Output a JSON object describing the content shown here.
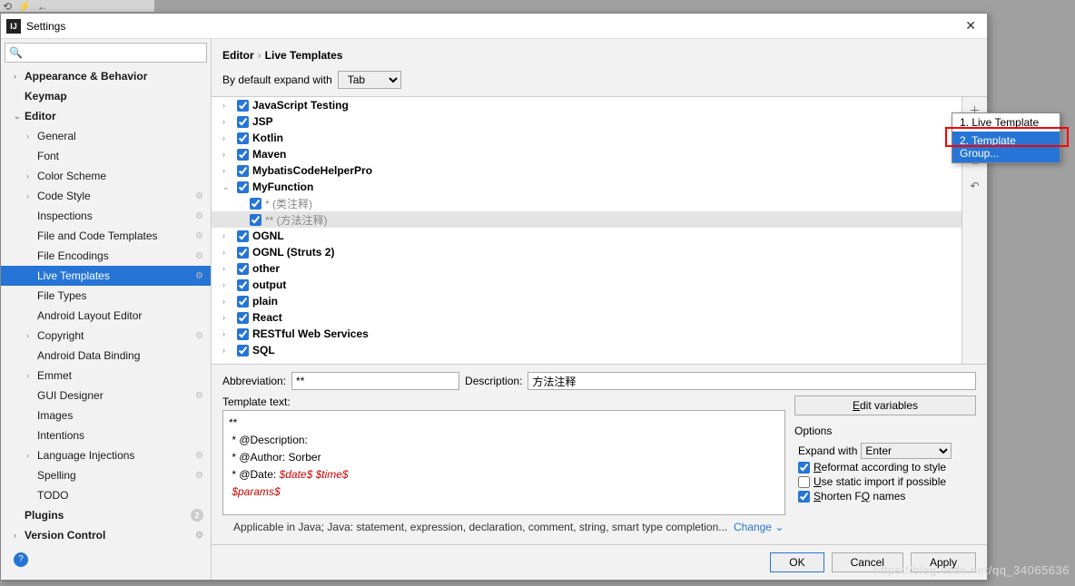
{
  "titlebar": {
    "title": "Settings"
  },
  "search": {
    "placeholder": ""
  },
  "sidebar": [
    {
      "label": "Appearance & Behavior",
      "lvl": 1,
      "bold": true,
      "arrow": "›"
    },
    {
      "label": "Keymap",
      "lvl": 1,
      "bold": true,
      "arrow": ""
    },
    {
      "label": "Editor",
      "lvl": 1,
      "bold": true,
      "arrow": "⌄"
    },
    {
      "label": "General",
      "lvl": 2,
      "arrow": "›"
    },
    {
      "label": "Font",
      "lvl": 2,
      "arrow": ""
    },
    {
      "label": "Color Scheme",
      "lvl": 2,
      "arrow": "›"
    },
    {
      "label": "Code Style",
      "lvl": 2,
      "arrow": "›",
      "gear": true
    },
    {
      "label": "Inspections",
      "lvl": 2,
      "arrow": "",
      "gear": true
    },
    {
      "label": "File and Code Templates",
      "lvl": 2,
      "arrow": "",
      "gear": true
    },
    {
      "label": "File Encodings",
      "lvl": 2,
      "arrow": "",
      "gear": true
    },
    {
      "label": "Live Templates",
      "lvl": 2,
      "arrow": "",
      "gear": true,
      "selected": true
    },
    {
      "label": "File Types",
      "lvl": 2,
      "arrow": ""
    },
    {
      "label": "Android Layout Editor",
      "lvl": 2,
      "arrow": ""
    },
    {
      "label": "Copyright",
      "lvl": 2,
      "arrow": "›",
      "gear": true
    },
    {
      "label": "Android Data Binding",
      "lvl": 2,
      "arrow": ""
    },
    {
      "label": "Emmet",
      "lvl": 2,
      "arrow": "›"
    },
    {
      "label": "GUI Designer",
      "lvl": 2,
      "arrow": "",
      "gear": true
    },
    {
      "label": "Images",
      "lvl": 2,
      "arrow": ""
    },
    {
      "label": "Intentions",
      "lvl": 2,
      "arrow": ""
    },
    {
      "label": "Language Injections",
      "lvl": 2,
      "arrow": "›",
      "gear": true
    },
    {
      "label": "Spelling",
      "lvl": 2,
      "arrow": "",
      "gear": true
    },
    {
      "label": "TODO",
      "lvl": 2,
      "arrow": ""
    },
    {
      "label": "Plugins",
      "lvl": 1,
      "bold": true,
      "arrow": "",
      "badge": "2"
    },
    {
      "label": "Version Control",
      "lvl": 1,
      "bold": true,
      "arrow": "›",
      "gear": true
    }
  ],
  "crumbs": {
    "a": "Editor",
    "b": "Live Templates"
  },
  "expand": {
    "label": "By default expand with",
    "value": "Tab"
  },
  "templates": [
    {
      "label": "JavaScript Testing",
      "arrow": "›",
      "bold": true
    },
    {
      "label": "JSP",
      "arrow": "›",
      "bold": true
    },
    {
      "label": "Kotlin",
      "arrow": "›",
      "bold": true
    },
    {
      "label": "Maven",
      "arrow": "›",
      "bold": true
    },
    {
      "label": "MybatisCodeHelperPro",
      "arrow": "›",
      "bold": true
    },
    {
      "label": "MyFunction",
      "arrow": "⌄",
      "bold": true
    },
    {
      "label": "* (类注释)",
      "child": true
    },
    {
      "label": "** (方法注释)",
      "child": true,
      "sel": true
    },
    {
      "label": "OGNL",
      "arrow": "›",
      "bold": true
    },
    {
      "label": "OGNL (Struts 2)",
      "arrow": "›",
      "bold": true
    },
    {
      "label": "other",
      "arrow": "›",
      "bold": true
    },
    {
      "label": "output",
      "arrow": "›",
      "bold": true
    },
    {
      "label": "plain",
      "arrow": "›",
      "bold": true
    },
    {
      "label": "React",
      "arrow": "›",
      "bold": true
    },
    {
      "label": "RESTful Web Services",
      "arrow": "›",
      "bold": true
    },
    {
      "label": "SQL",
      "arrow": "›",
      "bold": true
    }
  ],
  "abbr": {
    "label": "Abbreviation:",
    "value": "**"
  },
  "desc": {
    "label": "Description:",
    "value": "方法注释"
  },
  "tpltext": {
    "label": "Template text:"
  },
  "code": {
    "l1": "**",
    "l2": " * @Description:",
    "l3": " * @Author: Sorber",
    "l4a": " * @Date: ",
    "l4b": "$date$ $time$",
    "l5": " $params$"
  },
  "editvars": "Edit variables",
  "opts": {
    "title": "Options",
    "expand": "Expand with",
    "expandval": "Enter",
    "o1": "Reformat according to style",
    "o2": "Use static import if possible",
    "o3": "Shorten FQ names"
  },
  "applicable": {
    "text": "Applicable in Java; Java: statement, expression, declaration, comment, string, smart type completion...",
    "change": "Change"
  },
  "buttons": {
    "ok": "OK",
    "cancel": "Cancel",
    "apply": "Apply"
  },
  "popup": {
    "i1": "1. Live Template",
    "i2": "2. Template Group..."
  },
  "watermark": "https://blog.csdn.net/qq_34065636"
}
